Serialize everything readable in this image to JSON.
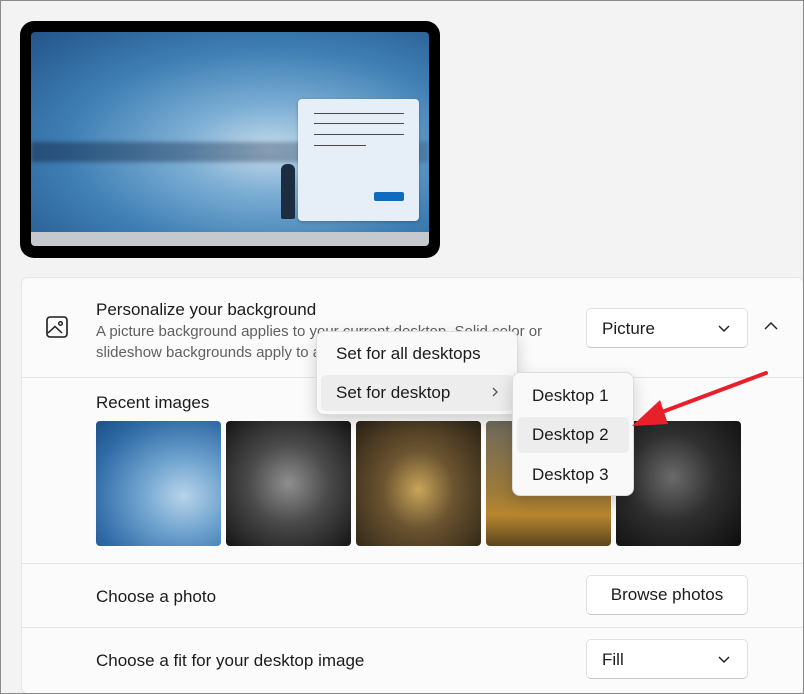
{
  "background": {
    "title": "Personalize your background",
    "description": "A picture background applies to your current desktop. Solid color or slideshow backgrounds apply to all your desktops.",
    "mode_dropdown": {
      "value": "Picture"
    }
  },
  "recent_images": {
    "label": "Recent images",
    "items": [
      "recent-image-1",
      "recent-image-2",
      "recent-image-3",
      "recent-image-4",
      "recent-image-5"
    ]
  },
  "choose_photo": {
    "label": "Choose a photo",
    "button": "Browse photos"
  },
  "choose_fit": {
    "label": "Choose a fit for your desktop image",
    "dropdown": {
      "value": "Fill"
    }
  },
  "context_menu": {
    "items": [
      {
        "label": "Set for all desktops"
      },
      {
        "label": "Set for desktop"
      }
    ]
  },
  "submenu": {
    "items": [
      {
        "label": "Desktop 1"
      },
      {
        "label": "Desktop 2"
      },
      {
        "label": "Desktop 3"
      }
    ],
    "highlighted": "Desktop 2"
  },
  "colors": {
    "accent": "#0f6cbd",
    "annotation_arrow": "#e8202a"
  }
}
